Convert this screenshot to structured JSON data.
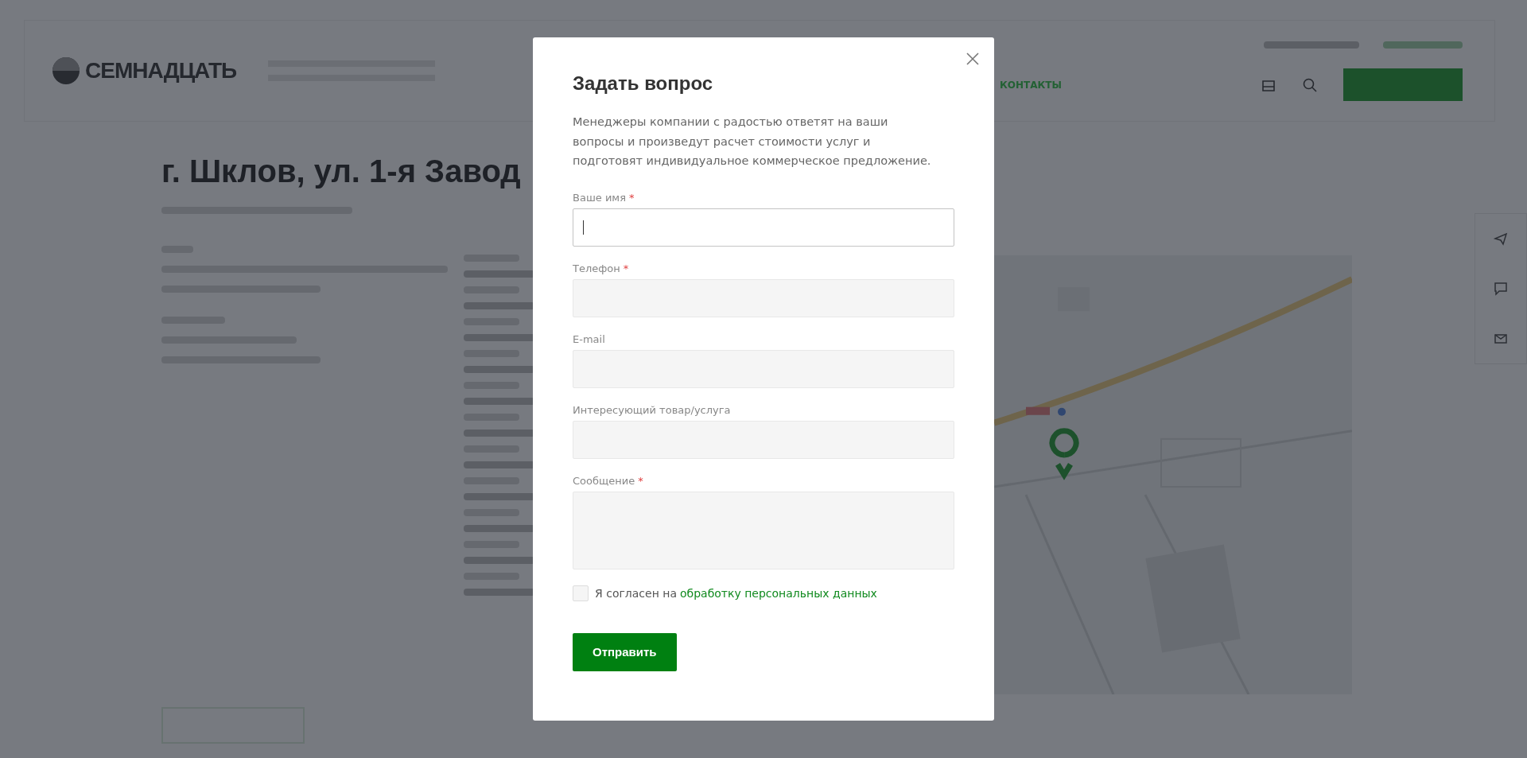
{
  "header": {
    "logo": "СЕМНАДЦАТЬ",
    "nav_item": "КОНТАКТЫ"
  },
  "page": {
    "title": "г. Шклов, ул. 1-я Завод"
  },
  "modal": {
    "title": "Задать вопрос",
    "description": "Менеджеры компании с радостью ответят на ваши вопросы и произведут расчет стоимости услуг и подготовят индивидуальное коммерческое предложение.",
    "required_mark": "*",
    "fields": [
      {
        "label": "Ваше имя",
        "required": true,
        "kind": "input",
        "focused": true
      },
      {
        "label": "Телефон",
        "required": true,
        "kind": "input",
        "focused": false
      },
      {
        "label": "E-mail",
        "required": false,
        "kind": "input",
        "focused": false
      },
      {
        "label": "Интересующий товар/услуга",
        "required": false,
        "kind": "input",
        "focused": false
      },
      {
        "label": "Сообщение",
        "required": true,
        "kind": "textarea",
        "focused": false
      }
    ],
    "consent": {
      "checked": false,
      "text": "Я согласен на",
      "link": "обработку персональных данных"
    },
    "submit": "Отправить"
  }
}
